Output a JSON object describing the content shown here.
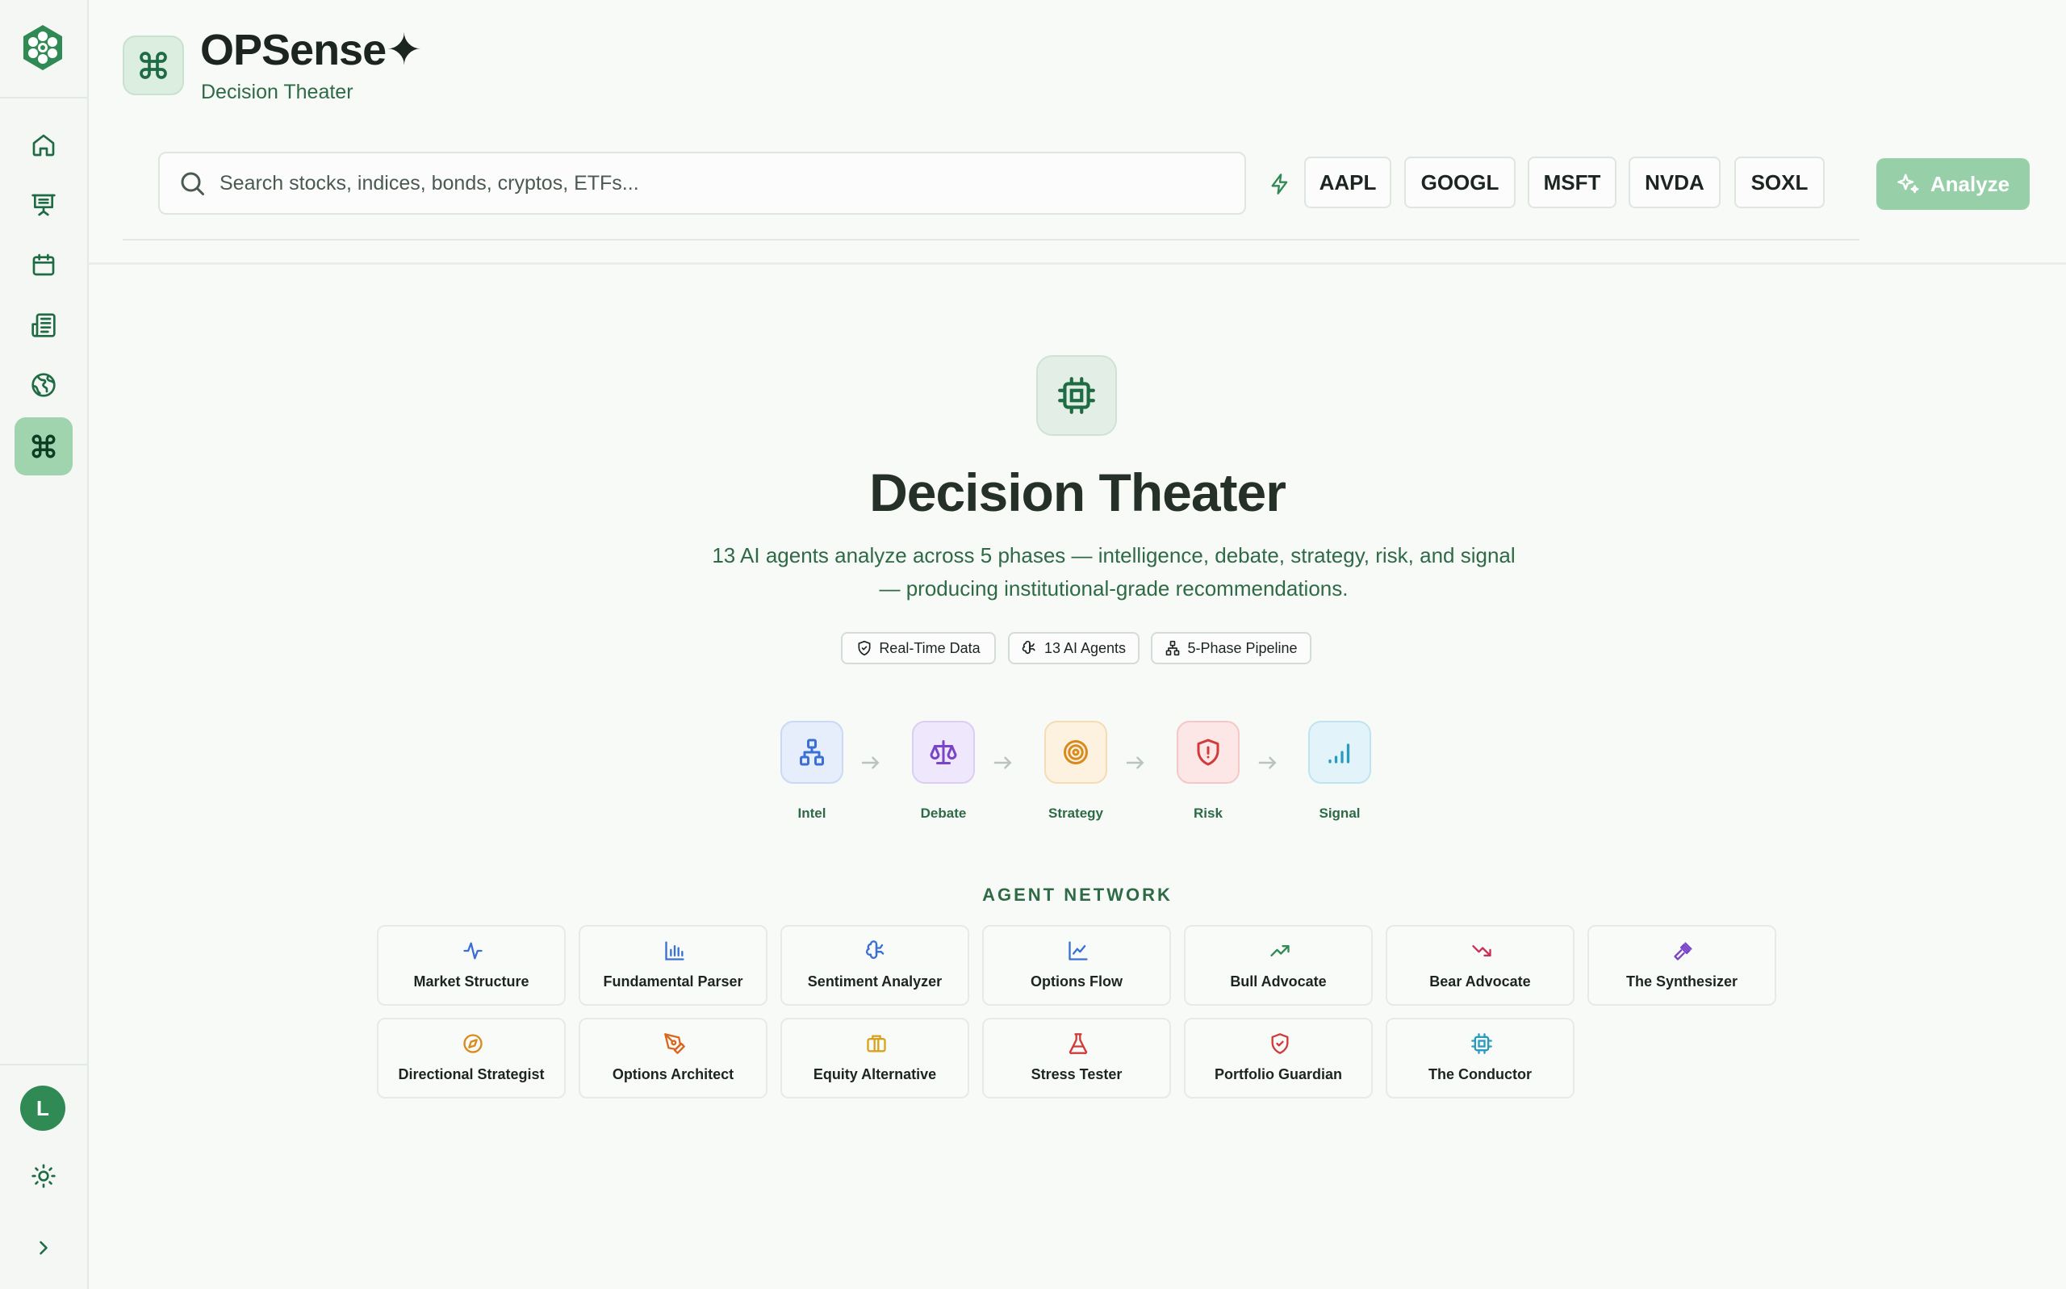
{
  "app": {
    "name": "OPSense✦",
    "subtitle": "Decision Theater"
  },
  "sidebar": {
    "items": [
      {
        "icon": "home-icon"
      },
      {
        "icon": "presentation-icon"
      },
      {
        "icon": "calendar-icon"
      },
      {
        "icon": "newspaper-icon"
      },
      {
        "icon": "globe-icon"
      },
      {
        "icon": "command-icon",
        "active": true
      }
    ],
    "avatar_initial": "L"
  },
  "search": {
    "placeholder": "Search stocks, indices, bonds, cryptos, ETFs...",
    "value": ""
  },
  "quick_tickers": [
    "AAPL",
    "GOOGL",
    "MSFT",
    "NVDA",
    "SOXL"
  ],
  "analyze_label": "Analyze",
  "hero": {
    "title": "Decision Theater",
    "description": "13 AI agents analyze across 5 phases — intelligence, debate, strategy, risk, and signal — producing institutional-grade recommendations.",
    "pills": [
      "Real-Time Data",
      "13 AI Agents",
      "5-Phase Pipeline"
    ]
  },
  "phases": [
    {
      "label": "Intel",
      "icon": "network-icon",
      "color": "#3b6fd4",
      "bg": "#e6eefc",
      "border": "#c9d9f6"
    },
    {
      "label": "Debate",
      "icon": "scale-icon",
      "color": "#7a44c9",
      "bg": "#efe7fb",
      "border": "#dccdf4"
    },
    {
      "label": "Strategy",
      "icon": "target-icon",
      "color": "#d98a1c",
      "bg": "#fdf1e0",
      "border": "#f5dcb5"
    },
    {
      "label": "Risk",
      "icon": "shield-alert-icon",
      "color": "#d23a3a",
      "bg": "#fde6e6",
      "border": "#f5c8c8"
    },
    {
      "label": "Signal",
      "icon": "signal-icon",
      "color": "#2a9ac0",
      "bg": "#e2f4fa",
      "border": "#bfe4f0"
    }
  ],
  "agent_network": {
    "title": "AGENT NETWORK",
    "agents": [
      {
        "name": "Market Structure",
        "icon": "activity-icon",
        "color": "#3b6fd4"
      },
      {
        "name": "Fundamental Parser",
        "icon": "bar-chart-icon",
        "color": "#3b6fd4"
      },
      {
        "name": "Sentiment Analyzer",
        "icon": "brain-icon",
        "color": "#3b6fd4"
      },
      {
        "name": "Options Flow",
        "icon": "line-chart-icon",
        "color": "#3b6fd4"
      },
      {
        "name": "Bull Advocate",
        "icon": "trending-up-icon",
        "color": "#2f8a54"
      },
      {
        "name": "Bear Advocate",
        "icon": "trending-down-icon",
        "color": "#c8325a"
      },
      {
        "name": "The Synthesizer",
        "icon": "gavel-icon",
        "color": "#7a44c9"
      },
      {
        "name": "Directional Strategist",
        "icon": "compass-icon",
        "color": "#d98a1c"
      },
      {
        "name": "Options Architect",
        "icon": "pen-tool-icon",
        "color": "#d9661c"
      },
      {
        "name": "Equity Alternative",
        "icon": "briefcase-icon",
        "color": "#d9a21c"
      },
      {
        "name": "Stress Tester",
        "icon": "flask-icon",
        "color": "#d23a3a"
      },
      {
        "name": "Portfolio Guardian",
        "icon": "shield-icon",
        "color": "#d23a3a"
      },
      {
        "name": "The Conductor",
        "icon": "cpu-icon",
        "color": "#2a9ac0"
      }
    ]
  }
}
